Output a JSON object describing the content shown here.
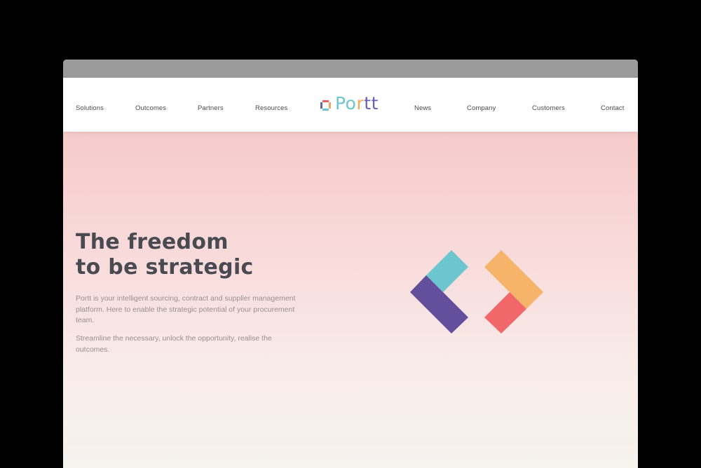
{
  "nav": {
    "left": [
      "Solutions",
      "Outcomes",
      "Partners",
      "Resources"
    ],
    "right": [
      "News",
      "Company",
      "Customers",
      "Contact"
    ]
  },
  "logo": {
    "word_part1": "Po",
    "word_part2": "r",
    "word_part3": "tt"
  },
  "hero": {
    "title_line1": "The freedom",
    "title_line2": "to be strategic",
    "paragraph1": "Portt is your intelligent sourcing, contract and supplier management platform. Here to enable the strategic potential of your procurement team.",
    "paragraph2": "Streamline the necessary, unlock the opportunity, realise the outcomes."
  },
  "colors": {
    "teal": "#6cc6cf",
    "orange": "#f6b36a",
    "purple": "#634f9b",
    "coral": "#f2676a",
    "text_dark": "#4a4a52",
    "hero_top": "#f6caca",
    "hero_bottom": "#f6f2ee"
  }
}
